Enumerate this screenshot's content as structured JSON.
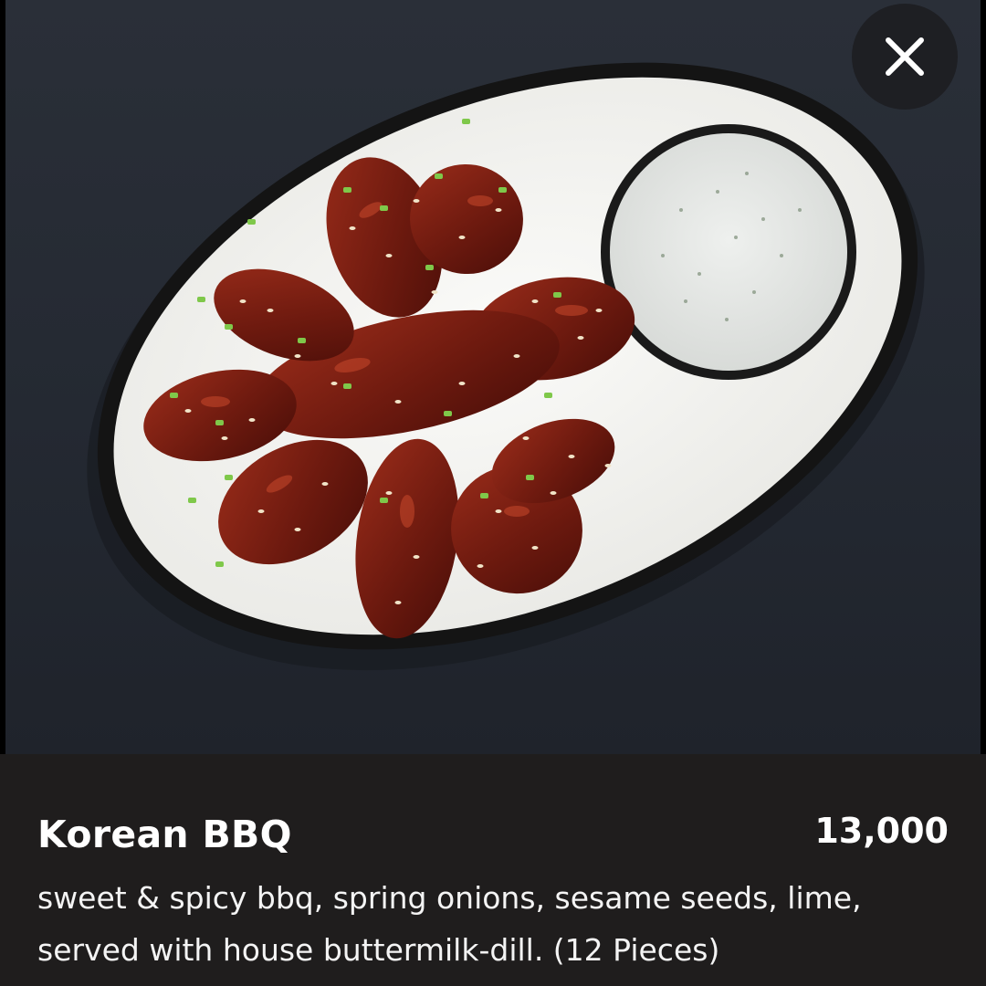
{
  "close_button": {
    "icon": "close-icon"
  },
  "dish_photo": {
    "subject": "plate"
  },
  "item": {
    "name": "Korean BBQ",
    "price": "13,000",
    "description": "sweet & spicy bbq, spring onions, sesame seeds, lime, served with house buttermilk-dill. (12 Pieces)"
  },
  "colors": {
    "background": "#000000",
    "photo_backdrop": "#242932",
    "info_panel": "#1f1d1d",
    "close_button_bg": "#1e1f23",
    "text": "#ffffff"
  }
}
